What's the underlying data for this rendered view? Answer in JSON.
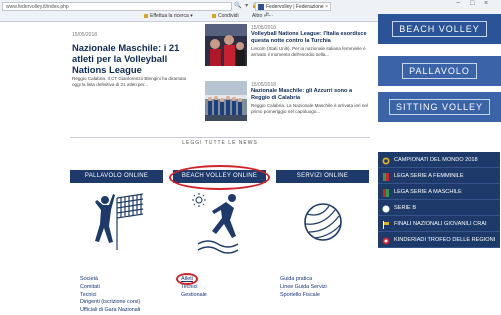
{
  "browser": {
    "address": "www.federvolley.it/index.php",
    "tab_title": "Federvolley | Federazione It...",
    "bookmarks": [
      "Effettua la ricerca",
      "Condividi",
      "Altro"
    ],
    "window_controls": [
      "−",
      "□",
      "×"
    ]
  },
  "news": [
    {
      "date": "15/05/2018",
      "title": "Nazionale Maschile: i 21 atleti per la Volleyball Nations League",
      "excerpt": "Reggio Calabria. Il CT Gianlorenzo Blengini ha diramato oggi la lista definitiva di 21 atleti per..."
    },
    {
      "date": "15/05/2018",
      "title": "Volleyball Nations League: l'Italia esordisce questa notte contro la Turchia",
      "excerpt": "Lincoln (Stati Uniti). Per la nazionale italiana femminile è arrivato il momento dell'esordio nella..."
    },
    {
      "date": "15/05/2018",
      "title": "Nazionale Maschile: gli Azzurri sono a Reggio di Calabria",
      "excerpt": "Reggio Calabria. La Nazionale Maschile è arrivata ieri nel primo pomeriggio nel capoluogo..."
    }
  ],
  "read_all": "LEGGI TUTTE LE NEWS",
  "columns": [
    {
      "header": "PALLAVOLO ONLINE",
      "icon": "volleyball-net-player-icon",
      "links": [
        "Società",
        "Comitati",
        "Tecnici",
        "Dirigenti (iscrizione corsi)",
        "Ufficiali di Gara Nazionali"
      ]
    },
    {
      "header": "BEACH VOLLEY ONLINE",
      "icon": "beach-volley-player-icon",
      "links": [
        "Atleti",
        "Tecnici",
        "Gestionale"
      ]
    },
    {
      "header": "SERVIZI ONLINE",
      "icon": "volleyball-ball-icon",
      "links": [
        "Guida pratica",
        "Linee Guida Servizi",
        "Sportello Fiscale"
      ]
    }
  ],
  "sidebar": {
    "banners": [
      "BEACH VOLLEY",
      "PALLAVOLO",
      "SITTING VOLLEY"
    ],
    "menu": [
      {
        "label": "CAMPIONATI DEL MONDO 2018",
        "icon": "trophy-icon"
      },
      {
        "label": "LEGA SERIE A FEMMINILE",
        "icon": "lega-femminile-icon"
      },
      {
        "label": "LEGA SERIE A MASCHILE",
        "icon": "lega-maschile-icon"
      },
      {
        "label": "SERIE B",
        "icon": "serie-b-icon"
      },
      {
        "label": "FINALI NAZIONALI GIOVANILI CRAI",
        "icon": "flag-icon"
      },
      {
        "label": "KINDERIADI TROFEO DELLE REGIONI",
        "icon": "kinderiadi-icon"
      }
    ]
  },
  "colors": {
    "navy": "#1d3a6b",
    "banner_blue": "#2b5398",
    "highlight_red": "#d0232a",
    "link_blue": "#14337a"
  }
}
